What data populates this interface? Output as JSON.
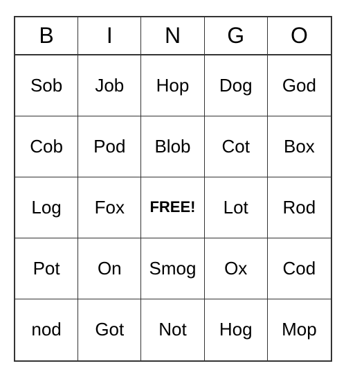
{
  "header": {
    "letters": [
      "B",
      "I",
      "N",
      "G",
      "O"
    ]
  },
  "grid": {
    "cells": [
      {
        "text": "Sob",
        "free": false
      },
      {
        "text": "Job",
        "free": false
      },
      {
        "text": "Hop",
        "free": false
      },
      {
        "text": "Dog",
        "free": false
      },
      {
        "text": "God",
        "free": false
      },
      {
        "text": "Cob",
        "free": false
      },
      {
        "text": "Pod",
        "free": false
      },
      {
        "text": "Blob",
        "free": false
      },
      {
        "text": "Cot",
        "free": false
      },
      {
        "text": "Box",
        "free": false
      },
      {
        "text": "Log",
        "free": false
      },
      {
        "text": "Fox",
        "free": false
      },
      {
        "text": "FREE!",
        "free": true
      },
      {
        "text": "Lot",
        "free": false
      },
      {
        "text": "Rod",
        "free": false
      },
      {
        "text": "Pot",
        "free": false
      },
      {
        "text": "On",
        "free": false
      },
      {
        "text": "Smog",
        "free": false
      },
      {
        "text": "Ox",
        "free": false
      },
      {
        "text": "Cod",
        "free": false
      },
      {
        "text": "nod",
        "free": false
      },
      {
        "text": "Got",
        "free": false
      },
      {
        "text": "Not",
        "free": false
      },
      {
        "text": "Hog",
        "free": false
      },
      {
        "text": "Mop",
        "free": false
      }
    ]
  }
}
